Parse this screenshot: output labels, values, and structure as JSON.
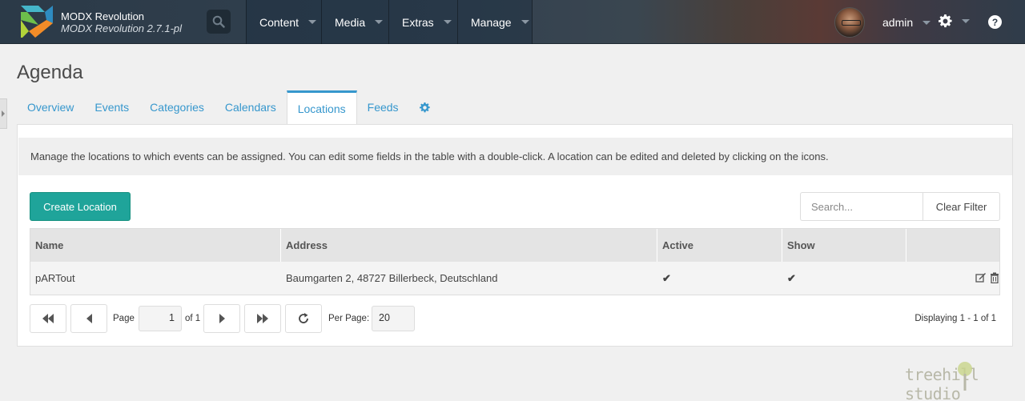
{
  "header": {
    "app_name": "MODX Revolution",
    "app_version": "MODX Revolution 2.7.1-pl",
    "search_icon": "search-icon",
    "menu": [
      {
        "label": "Content"
      },
      {
        "label": "Media"
      },
      {
        "label": "Extras"
      },
      {
        "label": "Manage"
      }
    ],
    "user": {
      "name": "admin"
    },
    "settings_icon": "gear-icon",
    "help_label": "?"
  },
  "page": {
    "title": "Agenda",
    "tabs": [
      {
        "label": "Overview",
        "active": false
      },
      {
        "label": "Events",
        "active": false
      },
      {
        "label": "Categories",
        "active": false
      },
      {
        "label": "Calendars",
        "active": false
      },
      {
        "label": "Locations",
        "active": true
      },
      {
        "label": "Feeds",
        "active": false
      }
    ],
    "settings_tab_icon": "gear-icon",
    "description": "Manage the locations to which events can be assigned. You can edit some fields in the table with a double-click. A location can be edited and deleted by clicking on the icons."
  },
  "toolbar": {
    "create_label": "Create Location",
    "search_placeholder": "Search...",
    "clear_label": "Clear Filter"
  },
  "grid": {
    "columns": [
      "Name",
      "Address",
      "Active",
      "Show",
      ""
    ],
    "rows": [
      {
        "name": "pARTout",
        "address": "Baumgarten 2, 48727 Billerbeck, Deutschland",
        "active": "✔",
        "show": "✔"
      }
    ]
  },
  "pager": {
    "page_label": "Page",
    "page_value": "1",
    "of_label": "of 1",
    "per_page_label": "Per Page:",
    "per_page_value": "20",
    "displaying": "Displaying 1 - 1 of 1"
  },
  "watermark": {
    "text": "treehill studio"
  },
  "colors": {
    "accent": "#3697cd",
    "primary_button": "#1fa49a",
    "check": "#5cb85c"
  }
}
